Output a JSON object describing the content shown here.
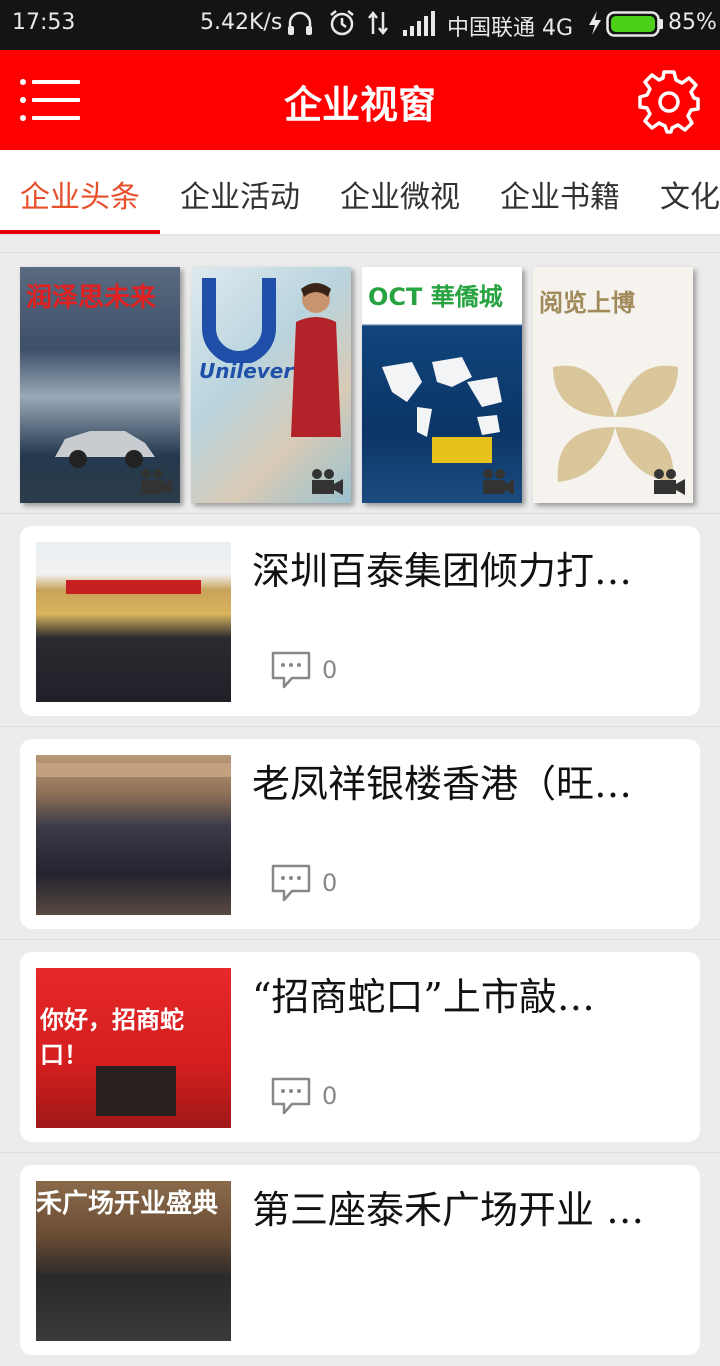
{
  "status_bar": {
    "time": "17:53",
    "net_speed": "5.42K/s",
    "carrier": "中国联通 4G",
    "battery": "85%",
    "icons": [
      "headphones-icon",
      "alarm-icon",
      "data-transfer-icon",
      "signal-icon",
      "charging-icon",
      "battery-icon"
    ]
  },
  "header": {
    "title": "企业视窗",
    "menu_icon": "menu-icon",
    "settings_icon": "gear-icon",
    "bg_color": "#ff0000"
  },
  "tabs": {
    "items": [
      {
        "label": "企业头条",
        "active": true
      },
      {
        "label": "企业活动",
        "active": false
      },
      {
        "label": "企业微视",
        "active": false
      },
      {
        "label": "企业书籍",
        "active": false
      },
      {
        "label": "文化",
        "active": false
      }
    ],
    "active_color": "#e8502a",
    "underline_color": "#e60000"
  },
  "covers": [
    {
      "title": "润泽思未来"
    },
    {
      "title": "Unilever"
    },
    {
      "title": "OCT 華僑城"
    },
    {
      "title": "阅览上博"
    }
  ],
  "news": [
    {
      "headline": "深圳百泰集团倾力打…",
      "comments": "0"
    },
    {
      "headline": "老凤祥银楼香港（旺…",
      "comments": "0"
    },
    {
      "headline": "“招商蛇口”上市敲…",
      "comments": "0"
    },
    {
      "headline": "第三座泰禾广场开业 …",
      "comments": ""
    }
  ],
  "thumb_captions": {
    "third": "你好，招商蛇口！",
    "fourth": "禾广场开业盛典"
  }
}
